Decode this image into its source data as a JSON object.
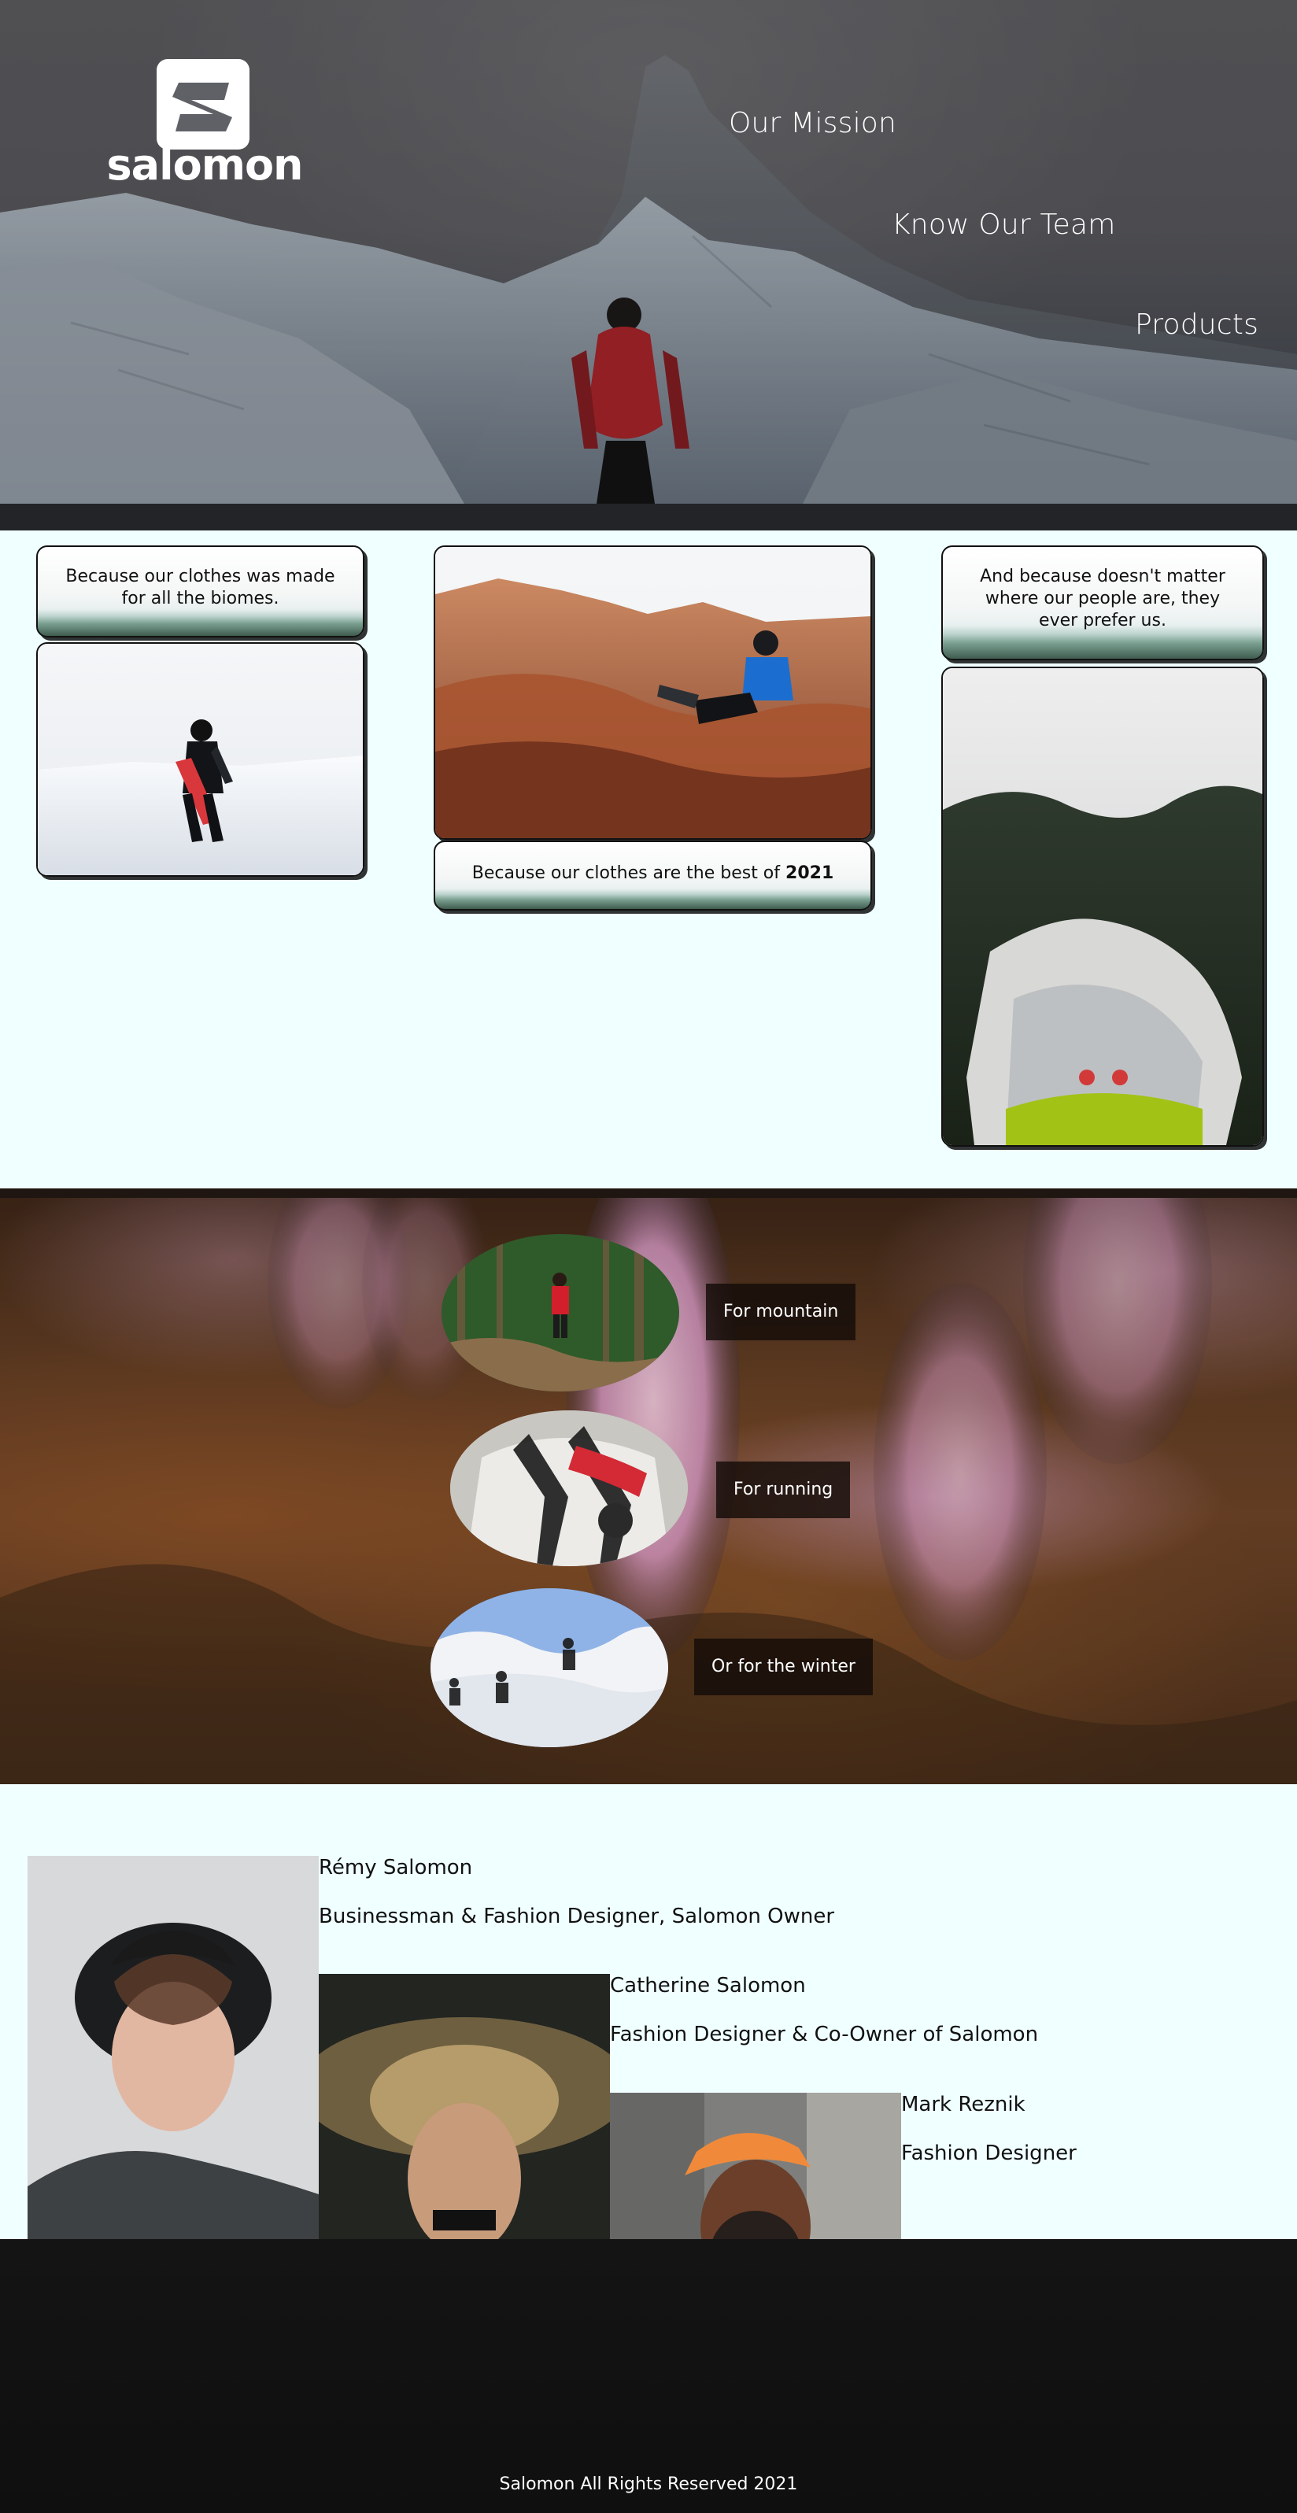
{
  "brand": {
    "name": "salomon"
  },
  "nav": {
    "items": [
      {
        "label": "Our Mission"
      },
      {
        "label": "Know Our Team"
      },
      {
        "label": "Products"
      }
    ]
  },
  "features": {
    "left_banner": "Because our clothes was made for all the biomes.",
    "middle_banner_prefix": "Because our clothes are the best of ",
    "middle_banner_year": "2021",
    "right_banner": "And because doesn't matter where our people are, they ever prefer us."
  },
  "categories": {
    "items": [
      {
        "label": "For mountain"
      },
      {
        "label": "For running"
      },
      {
        "label": "Or for the winter"
      }
    ]
  },
  "team": {
    "members": [
      {
        "name": "Rémy Salomon",
        "role": "Businessman & Fashion Designer, Salomon Owner"
      },
      {
        "name": "Catherine Salomon",
        "role": "Fashion Designer & Co-Owner of Salomon"
      },
      {
        "name": "Mark Reznik",
        "role": "Fashion Designer"
      }
    ]
  },
  "footer": {
    "text": "Salomon All Rights Reserved 2021"
  },
  "colors": {
    "page_background": "#f0ffff",
    "footer_background": "#121212",
    "tag_background": "#140c08",
    "hero_strip": "#222427"
  },
  "icons": {
    "logo": "salomon-s-icon"
  }
}
